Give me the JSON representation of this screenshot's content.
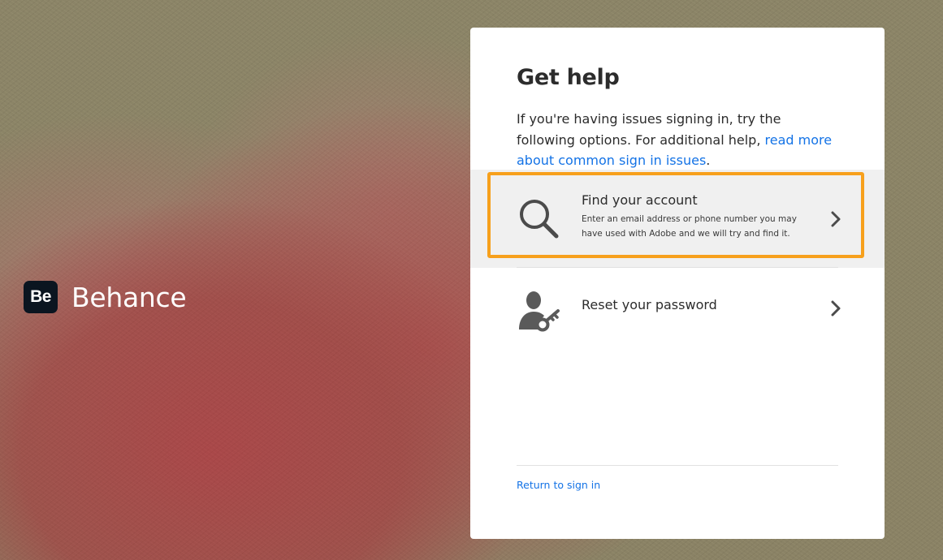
{
  "brand": {
    "logo_text": "Be",
    "name": "Behance"
  },
  "card": {
    "title": "Get help",
    "description_prefix": "If you're having issues signing in, try the following options. For additional help, ",
    "description_link": "read more about common sign in issues",
    "description_suffix": "."
  },
  "options": [
    {
      "title": "Find your account",
      "subtitle": "Enter an email address or phone number you may have used with Adobe and we will try and find it.",
      "icon": "search-icon",
      "highlighted": true
    },
    {
      "title": "Reset your password",
      "subtitle": "",
      "icon": "user-key-icon",
      "highlighted": false
    }
  ],
  "footer": {
    "return_link": "Return to sign in"
  },
  "colors": {
    "link": "#1473e6",
    "highlight": "#f7a01c",
    "option_hover_bg": "#f0f0f0",
    "text": "#2c2c2c"
  }
}
